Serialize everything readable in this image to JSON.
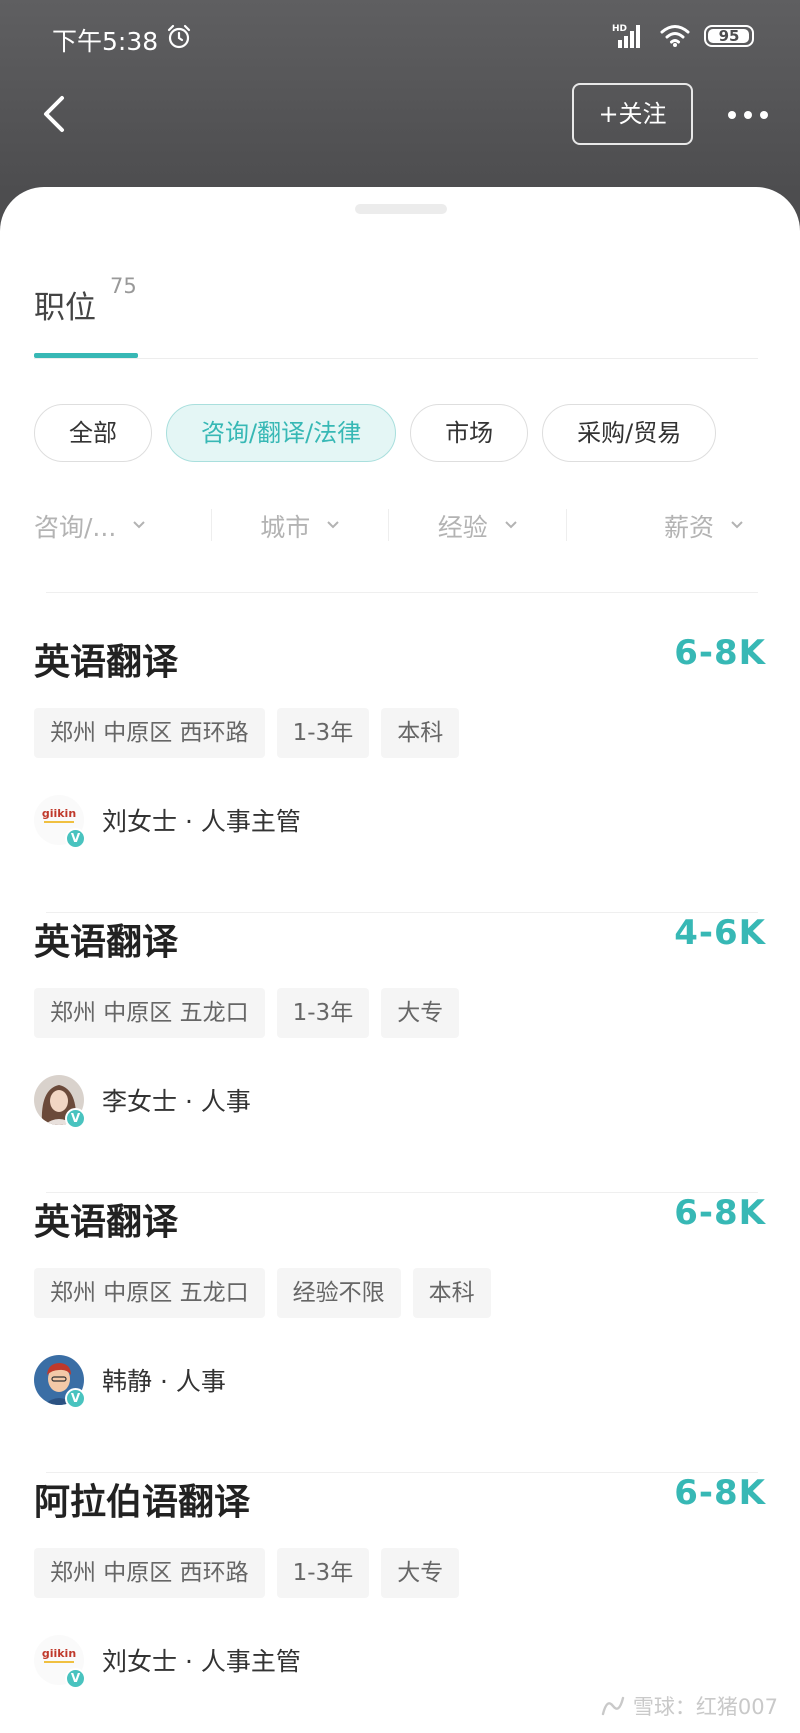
{
  "status_bar": {
    "time": "下午5:38",
    "network": "HD",
    "battery": "95"
  },
  "nav": {
    "follow_label": "+关注"
  },
  "tab": {
    "title": "职位",
    "count": "75"
  },
  "chips": [
    {
      "label": "全部",
      "active": false
    },
    {
      "label": "咨询/翻译/法律",
      "active": true
    },
    {
      "label": "市场",
      "active": false
    },
    {
      "label": "采购/贸易",
      "active": false
    }
  ],
  "filters": [
    {
      "label": "咨询/..."
    },
    {
      "label": "城市"
    },
    {
      "label": "经验"
    },
    {
      "label": "薪资"
    }
  ],
  "jobs": [
    {
      "title": "英语翻译",
      "salary": "6-8K",
      "tags": [
        "郑州 中原区 西环路",
        "1-3年",
        "本科"
      ],
      "recruiter": "刘女士 · 人事主管",
      "avatar": "giikin-logo"
    },
    {
      "title": "英语翻译",
      "salary": "4-6K",
      "tags": [
        "郑州 中原区 五龙口",
        "1-3年",
        "大专"
      ],
      "recruiter": "李女士 · 人事",
      "avatar": "photo-woman"
    },
    {
      "title": "英语翻译",
      "salary": "6-8K",
      "tags": [
        "郑州 中原区 五龙口",
        "经验不限",
        "本科"
      ],
      "recruiter": "韩静 · 人事",
      "avatar": "cartoon-man"
    },
    {
      "title": "阿拉伯语翻译",
      "salary": "6-8K",
      "tags": [
        "郑州 中原区 西环路",
        "1-3年",
        "大专"
      ],
      "recruiter": "刘女士 · 人事主管",
      "avatar": "giikin-logo"
    }
  ],
  "avatar_logo_text": "giikin",
  "verified_badge": "V",
  "watermark": "雪球：红猪007",
  "colors": {
    "accent": "#37b8b5",
    "header_bg": "#4d4d4f"
  }
}
